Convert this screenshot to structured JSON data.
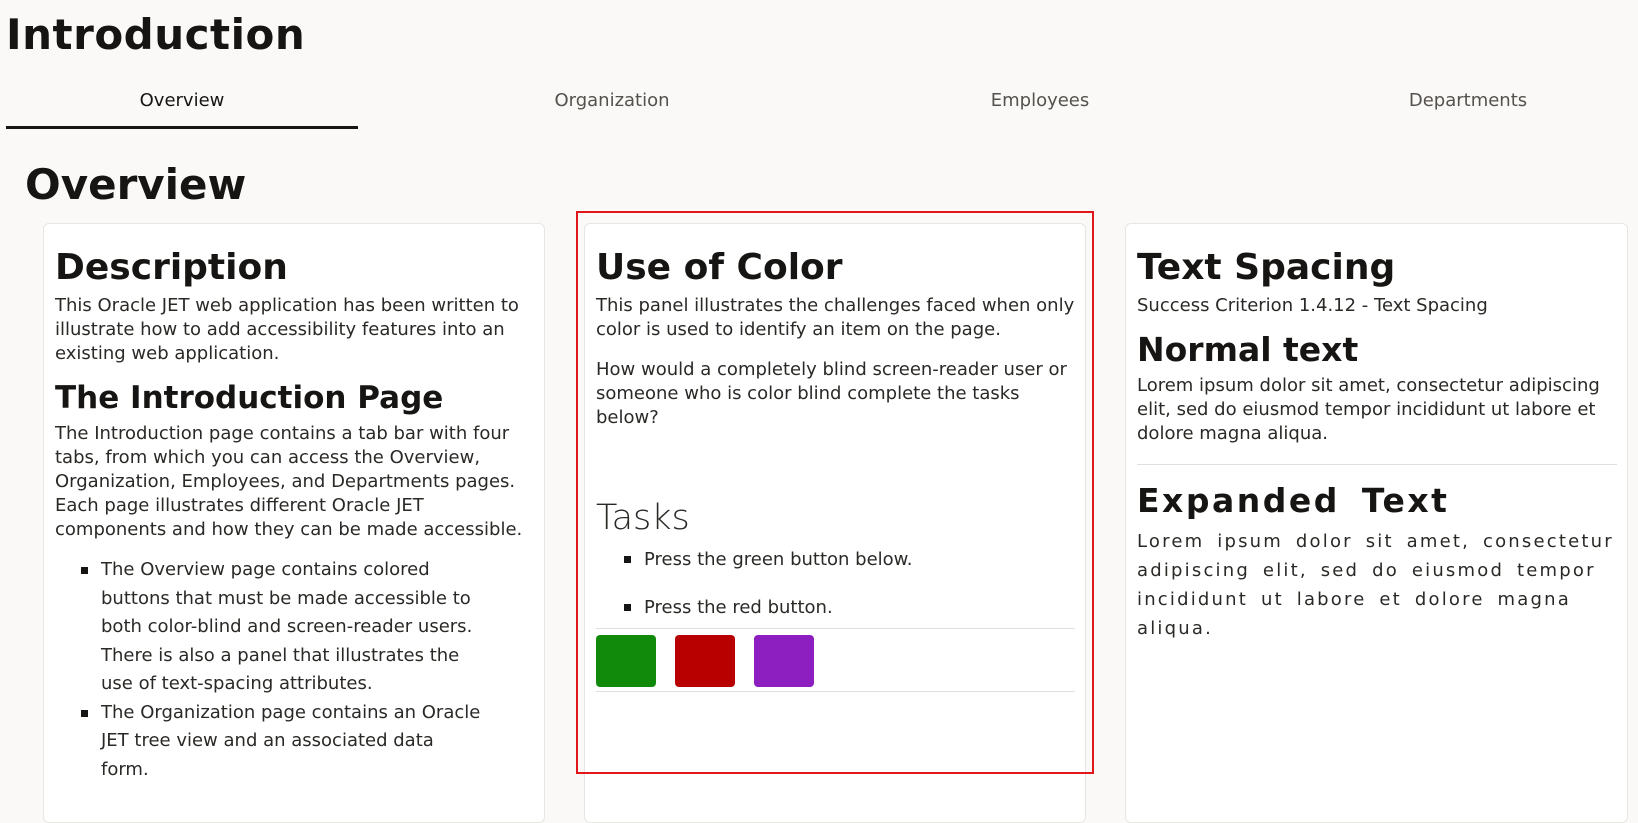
{
  "page": {
    "title": "Introduction"
  },
  "tabs": [
    {
      "label": "Overview",
      "selected": true
    },
    {
      "label": "Organization",
      "selected": false
    },
    {
      "label": "Employees",
      "selected": false
    },
    {
      "label": "Departments",
      "selected": false
    }
  ],
  "overview": {
    "title": "Overview",
    "description_card": {
      "heading": "Description",
      "intro": "This Oracle JET web application has been written to illustrate how to add accessibility features into an existing web application.",
      "subheading": "The Introduction Page",
      "body": "The Introduction page contains a tab bar with four tabs, from which you can access the Overview, Organization, Employees, and Departments pages. Each page illustrates different Oracle JET components and how they can be made accessible.",
      "bullets": [
        "The Overview page contains colored buttons that must be made accessible to both color-blind and screen-reader users. There is also a panel that illustrates the use of text-spacing attributes.",
        "The Organization page contains an Oracle JET tree view and an associated data form."
      ]
    },
    "color_card": {
      "heading": "Use of Color",
      "para1": "This panel illustrates the challenges faced when only color is used to identify an item on the page.",
      "para2": "How would a completely blind screen-reader user or someone who is color blind complete the tasks below?",
      "tasks_heading": "Tasks",
      "tasks": [
        "Press the green button below.",
        "Press the red button."
      ],
      "buttons": [
        {
          "name": "green-button",
          "color": "#118a0b"
        },
        {
          "name": "red-button",
          "color": "#b80000"
        },
        {
          "name": "purple-button",
          "color": "#8d1ec0"
        }
      ],
      "highlight_color": "#e0161b"
    },
    "spacing_card": {
      "heading": "Text Spacing",
      "criterion": "Success Criterion 1.4.12 - Text Spacing",
      "normal_heading": "Normal text",
      "normal_body": "Lorem ipsum dolor sit amet, consectetur adipiscing elit, sed do eiusmod tempor incididunt ut labore et dolore magna aliqua.",
      "expanded_heading": "Expanded Text",
      "expanded_body": "Lorem ipsum dolor sit amet, consectetur adipiscing elit, sed do eiusmod tempor incididunt ut labore et dolore magna aliqua."
    }
  }
}
